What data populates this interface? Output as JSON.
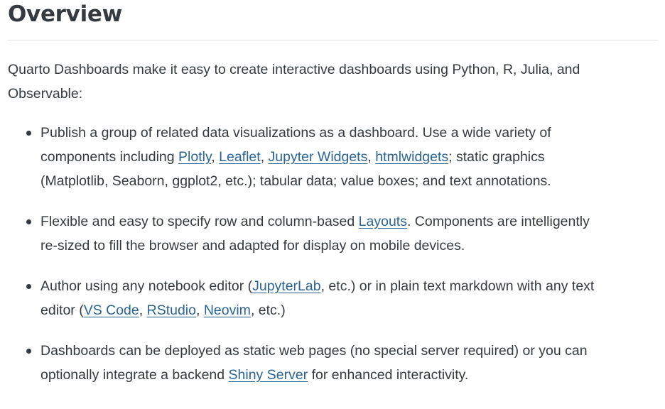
{
  "heading": "Overview",
  "intro": {
    "line1": "Quarto Dashboards make it easy to create interactive dashboards using Python, R, Julia, and",
    "line2": "Observable:"
  },
  "items": [
    {
      "t1": "Publish a group of related data visualizations as a dashboard. Use a wide variety of",
      "t2": "components including ",
      "l1": "Plotly",
      "s1": ", ",
      "l2": "Leaflet",
      "s2": ", ",
      "l3": "Jupyter Widgets",
      "s3": ", ",
      "l4": "htmlwidgets",
      "t3": "; static graphics",
      "t4": "(Matplotlib, Seaborn, ggplot2, etc.); tabular data; value boxes; and text annotations."
    },
    {
      "t1": "Flexible and easy to specify row and column-based ",
      "l1": "Layouts",
      "t2": ". Components are intelligently",
      "t3": "re-sized to fill the browser and adapted for display on mobile devices."
    },
    {
      "t1": "Author using any notebook editor (",
      "l1": "JupyterLab",
      "t2": ", etc.) or in plain text markdown with any text",
      "t3": "editor (",
      "l2": "VS Code",
      "s1": ", ",
      "l3": "RStudio",
      "s2": ", ",
      "l4": "Neovim",
      "t4": ", etc.)"
    },
    {
      "t1": "Dashboards can be deployed as static web pages (no special server required) or you can",
      "t2": "optionally integrate a backend ",
      "l1": "Shiny Server",
      "t3": " for enhanced interactivity."
    }
  ],
  "colors": {
    "text": "#343a40",
    "link": "#2a6496",
    "rule": "#dee2e6"
  }
}
